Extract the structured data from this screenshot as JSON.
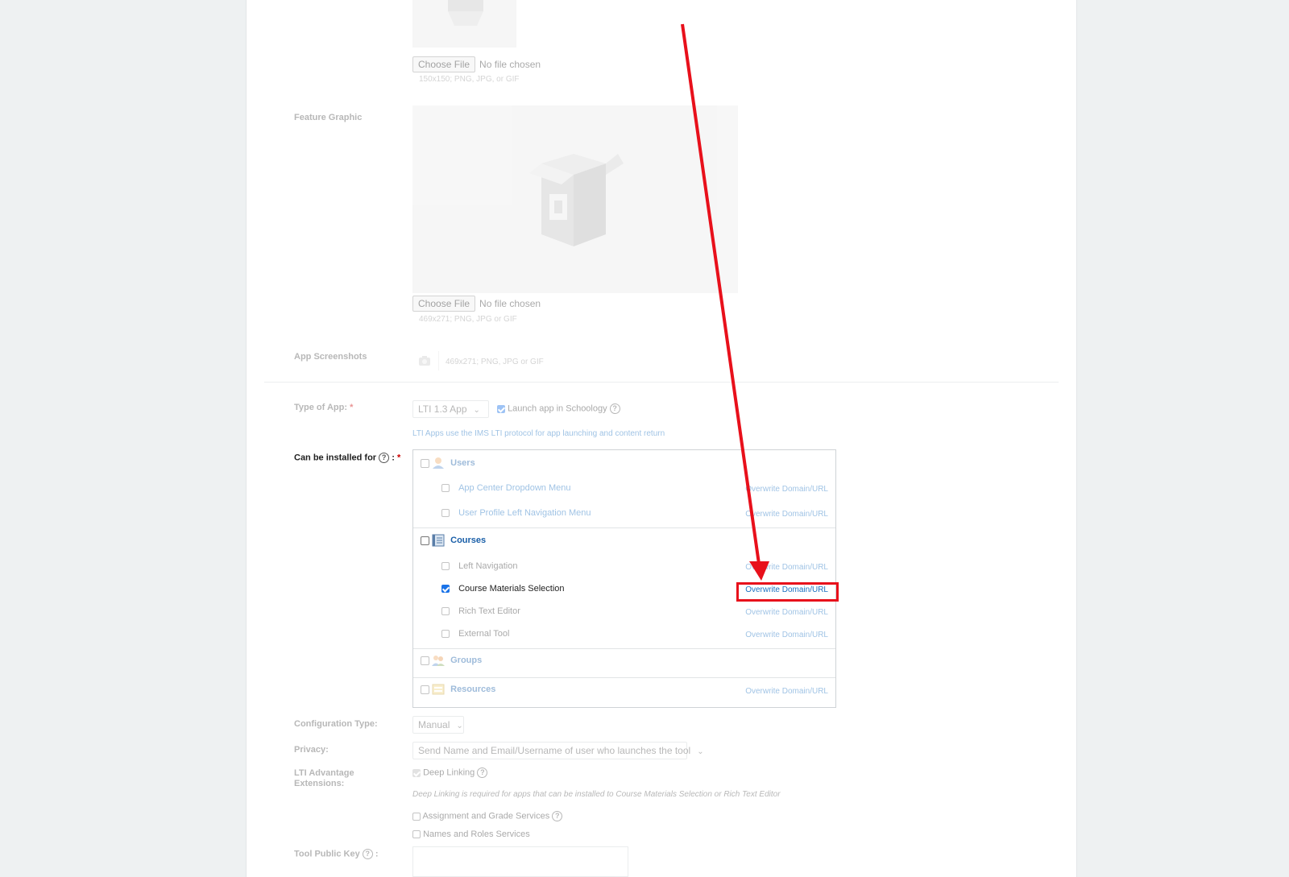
{
  "form": {
    "icon": {
      "choose_file": "Choose File",
      "file_status": "No file chosen",
      "hint": "150x150; PNG, JPG, or GIF"
    },
    "feature_graphic": {
      "label": "Feature Graphic",
      "choose_file": "Choose File",
      "file_status": "No file chosen",
      "hint": "469x271; PNG, JPG or GIF"
    },
    "app_screenshots": {
      "label": "App Screenshots",
      "hint": "469x271; PNG, JPG or GIF"
    },
    "type_of_app": {
      "label": "Type of App:",
      "required": "*",
      "selected": "LTI 1.3 App",
      "launch_label": "Launch app in Schoology",
      "launch_checked": true,
      "help_text": "LTI Apps use the IMS LTI protocol for app launching and content return"
    },
    "installed_for": {
      "label": "Can be installed for",
      "help": "?",
      "suffix": ":",
      "required": "*",
      "overwrite_label": "Overwrite Domain/URL",
      "groups": {
        "users": {
          "title": "Users",
          "items": [
            "App Center Dropdown Menu",
            "User Profile Left Navigation Menu"
          ]
        },
        "courses": {
          "title": "Courses",
          "items": [
            "Left Navigation",
            "Course Materials Selection",
            "Rich Text Editor",
            "External Tool"
          ]
        },
        "groups": {
          "title": "Groups"
        },
        "resources": {
          "title": "Resources"
        }
      }
    },
    "configuration_type": {
      "label": "Configuration Type:",
      "selected": "Manual"
    },
    "privacy": {
      "label": "Privacy:",
      "selected": "Send Name and Email/Username of user who launches the tool"
    },
    "lti_extensions": {
      "label_line1": "LTI Advantage",
      "label_line2": "Extensions:",
      "deep_linking": "Deep Linking",
      "deep_linking_note": "Deep Linking is required for apps that can be installed to Course Materials Selection or Rich Text Editor",
      "assignment_grade": "Assignment and Grade Services",
      "names_roles": "Names and Roles Services"
    },
    "tool_public_key": {
      "label": "Tool Public Key",
      "help": "?",
      "suffix": ":"
    }
  },
  "colors": {
    "annotation_red": "#e8101b",
    "link_blue": "#1a6fc0",
    "checkbox_blue": "#1a73e8"
  }
}
